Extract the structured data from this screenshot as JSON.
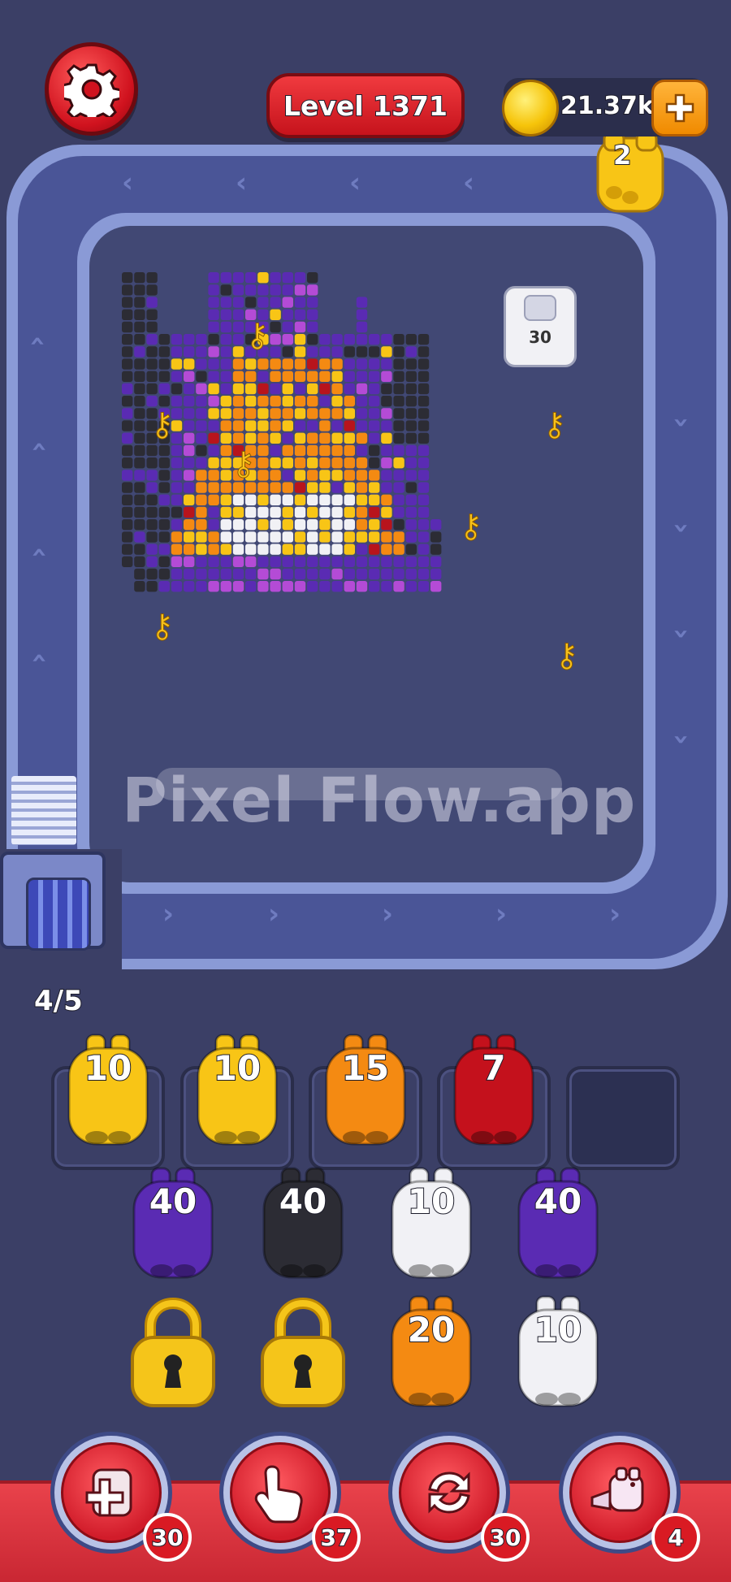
{
  "header": {
    "level_label": "Level 1371",
    "coins": "21.37k"
  },
  "carrier": {
    "count": "2"
  },
  "board": {
    "white_block_count": "30",
    "watermark": "Pixel Flow.app"
  },
  "queue": {
    "progress": "4/5",
    "slots": [
      {
        "count": "10",
        "color": "#f8c516"
      },
      {
        "count": "10",
        "color": "#f8c516"
      },
      {
        "count": "15",
        "color": "#f48a12"
      },
      {
        "count": "7",
        "color": "#c4111c"
      },
      {
        "count": "",
        "color": "empty"
      }
    ]
  },
  "stock": {
    "row1": [
      {
        "count": "40",
        "color": "#5a2bb3"
      },
      {
        "count": "40",
        "color": "#2c2c34"
      },
      {
        "count": "10",
        "color": "#f1f1f5"
      },
      {
        "count": "40",
        "color": "#5a2bb3"
      }
    ],
    "row2": [
      {
        "state": "locked",
        "color": "#f5c51a"
      },
      {
        "state": "locked",
        "color": "#f5c51a"
      },
      {
        "count": "20",
        "color": "#f48a12"
      },
      {
        "count": "10",
        "color": "#f1f1f5"
      }
    ]
  },
  "boosters": [
    {
      "name": "add-slot",
      "count": "30"
    },
    {
      "name": "tap",
      "count": "37"
    },
    {
      "name": "shuffle",
      "count": "30"
    },
    {
      "name": "train",
      "count": "4"
    }
  ],
  "colors": {
    "purple": "#5a2bb3",
    "black": "#2c2c34",
    "orange": "#f48a12",
    "yellow": "#f8c516",
    "red": "#b8141c",
    "white": "#f1f1f5",
    "magenta": "#b44bd6"
  }
}
